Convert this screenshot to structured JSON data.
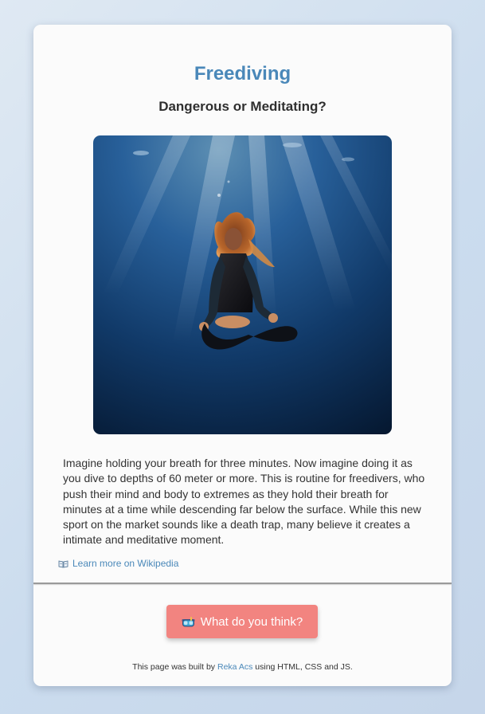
{
  "page": {
    "title": "Freediving",
    "subtitle": "Dangerous or Meditating?"
  },
  "image": {
    "alt": "Freediver meditating underwater"
  },
  "description": "Imagine holding your breath for three minutes. Now imagine doing it as you dive to depths of 60 meter or more. This is routine for freedivers, who push their mind and body to extremes as they hold their breath for minutes at a time while descending far below the surface. While this new sport on the market sounds like a death trap, many believe it creates a intimate and meditative moment.",
  "wiki_link": {
    "icon": "open-book-icon",
    "label": "Learn more on Wikipedia"
  },
  "cta": {
    "icon": "diving-mask-icon",
    "label": "What do you think?"
  },
  "footer": {
    "prefix": "This page was built by",
    "author": "Reka Acs",
    "suffix": "using HTML, CSS and JS."
  },
  "colors": {
    "accent": "#4a88b9",
    "button": "#f28480",
    "card": "#fbfbfb"
  }
}
